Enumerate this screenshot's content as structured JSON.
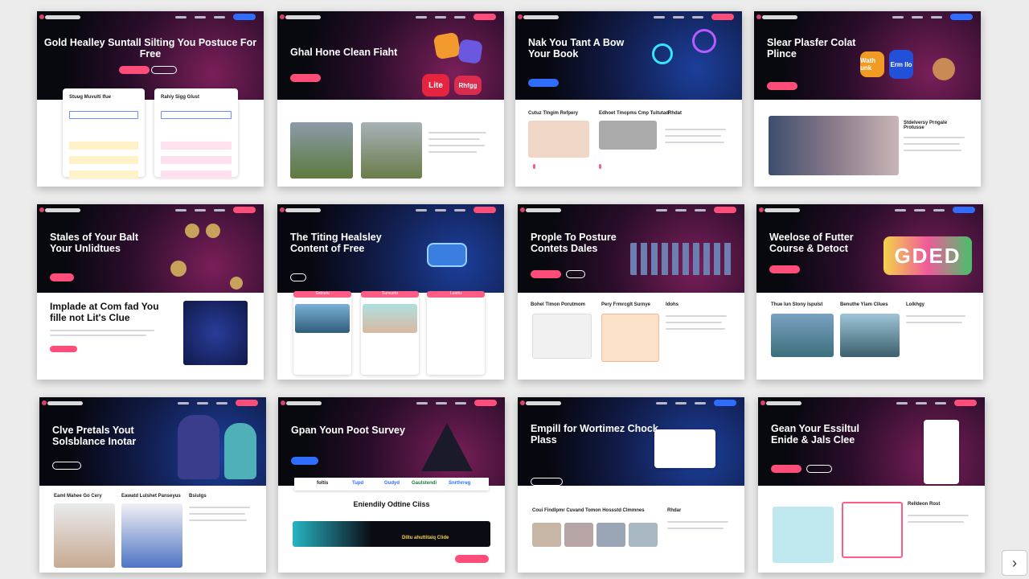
{
  "gallery": {
    "cards": [
      {
        "headline": "Gold Healley Suntall Silting You Postuce For Free",
        "labels": [
          "Stuug Muvulti Ifue",
          "Rahiy Sigg Glust"
        ]
      },
      {
        "headline": "Ghal Hone Clean Fiaht",
        "labels": [
          "Lite",
          "Rhfgg"
        ]
      },
      {
        "headline": "Nak You Tant A Bow Your Book",
        "labels": [
          "Cutuz Tlngim Refpery",
          "Edhoet Tmopms Cmp Tuitutad",
          "Rhdat"
        ]
      },
      {
        "headline": "Slear Plasfer Colat Plince",
        "labels": [
          "Wath unk",
          "Erm llo",
          "Stdelversy Prngale Protusse"
        ]
      },
      {
        "headline": "Stales of Your Balt Your Unlidtues",
        "labels": [
          "Implade at Com fad You fille not Lit's Clue"
        ]
      },
      {
        "headline": "The Titing Healsley Content of Free",
        "labels": [
          "Sotoutu",
          "Survuetu",
          "Luutru"
        ]
      },
      {
        "headline": "Prople To Posture Contets Dales",
        "labels": [
          "Bohel Tlmon Porutmom",
          "Pery Frmrcglt Surnye",
          "Idohs"
        ]
      },
      {
        "headline": "Weelose of Futter Course & Detoct",
        "labels": [
          "GDED",
          "Thue Iun Stony Ispulst",
          "Benuthe Ylam Cllues",
          "Lolkhgy"
        ]
      },
      {
        "headline": "Clve Pretals Yout Solsblance Inotar",
        "labels": [
          "Eaml Mahee Go Cery",
          "Eawatd Lulshet Panseyus",
          "Bsiulgs"
        ]
      },
      {
        "headline": "Gpan Youn Poot Survey",
        "labels": [
          "Eniendily Odtine Ciiss",
          "foltis",
          "Tupd",
          "Gudyd",
          "Gaulstendi",
          "Snrthrreg",
          "Diltu ahuttitaiq Clide"
        ]
      },
      {
        "headline": "Empill for Wortimez Chock Plass",
        "labels": [
          "Coui Findlpmr Cuvand Tomon Hossstd Clmmnes",
          "Rhdar"
        ]
      },
      {
        "headline": "Gean Your Essiltul Enide & Jals Clee",
        "labels": [
          "Relldeon Rost"
        ]
      }
    ]
  },
  "controls": {
    "next_label": "›"
  },
  "colors": {
    "accent": "#ff4d7a",
    "blue": "#2f6dff",
    "dark": "#08080f"
  },
  "icons": {
    "next": "chevron-right-icon"
  }
}
